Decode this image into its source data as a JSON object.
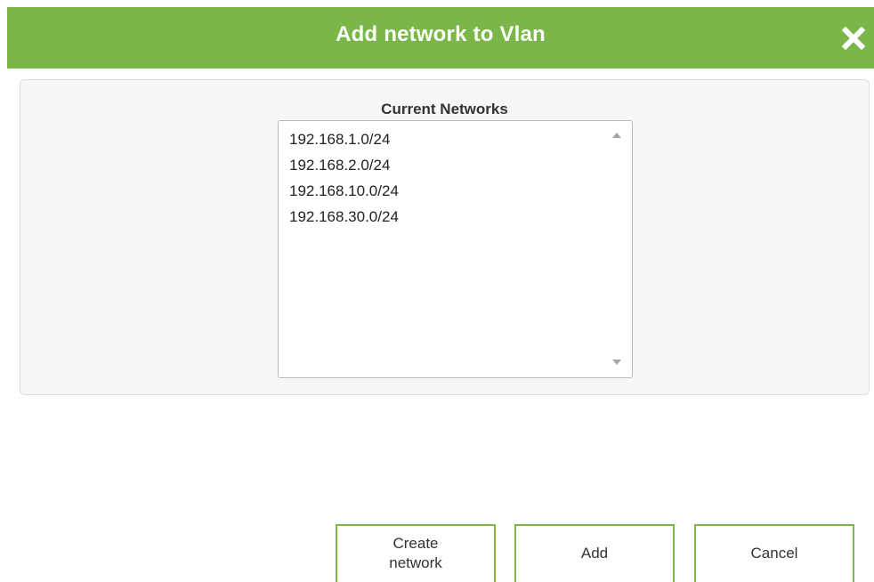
{
  "dialog": {
    "title": "Add network to Vlan",
    "close_icon": "close-icon",
    "accent_color": "#7ab648"
  },
  "networks": {
    "label": "Current Networks",
    "items": [
      "192.168.1.0/24",
      "192.168.2.0/24",
      "192.168.10.0/24",
      "192.168.30.0/24"
    ]
  },
  "buttons": {
    "create_network": "Create network",
    "add": "Add",
    "cancel": "Cancel"
  }
}
